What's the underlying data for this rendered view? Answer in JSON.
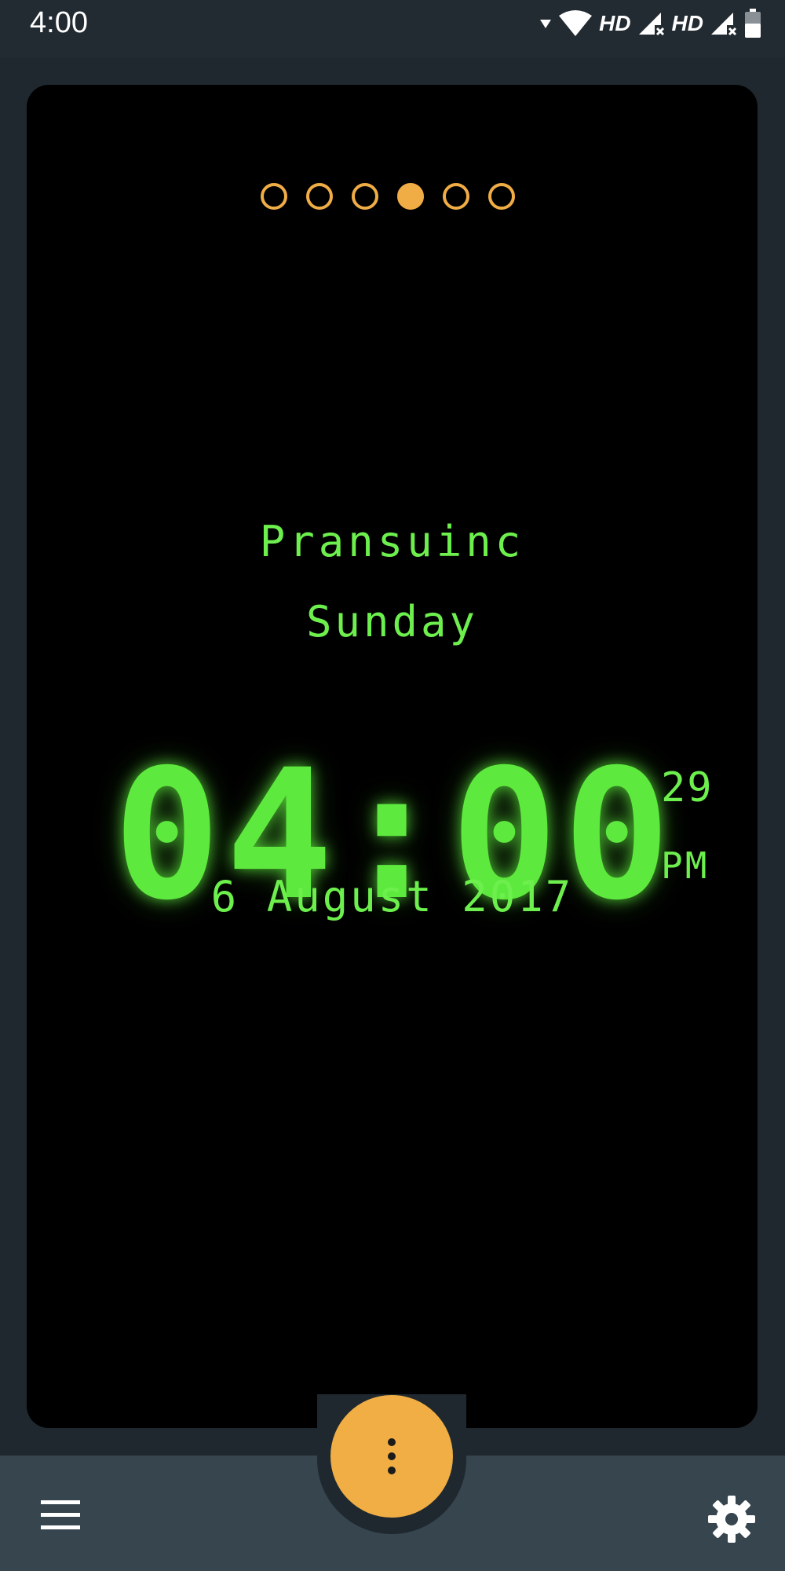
{
  "status_bar": {
    "time": "4:00",
    "hd_label_1": "HD",
    "hd_label_2": "HD",
    "icons": [
      "data-arrow-icon",
      "wifi-icon",
      "signal-x-icon",
      "signal-x-icon",
      "battery-icon"
    ]
  },
  "pager": {
    "page_count": 6,
    "active_page": 4
  },
  "clock": {
    "brand": "Pransuinc",
    "day": "Sunday",
    "time": "04:00",
    "seconds": "29",
    "ampm": "PM",
    "date": "6 August 2017"
  },
  "bottom_bar": {
    "left_icon": "hamburger-menu-icon",
    "center_icon": "more-vertical-icon",
    "right_icon": "gear-icon"
  },
  "colors": {
    "accent": "#f0ae44",
    "clock_green": "#5ee93e",
    "card_bg": "#000000",
    "page_bg": "#1f282f",
    "bar_bg": "#37454f"
  }
}
